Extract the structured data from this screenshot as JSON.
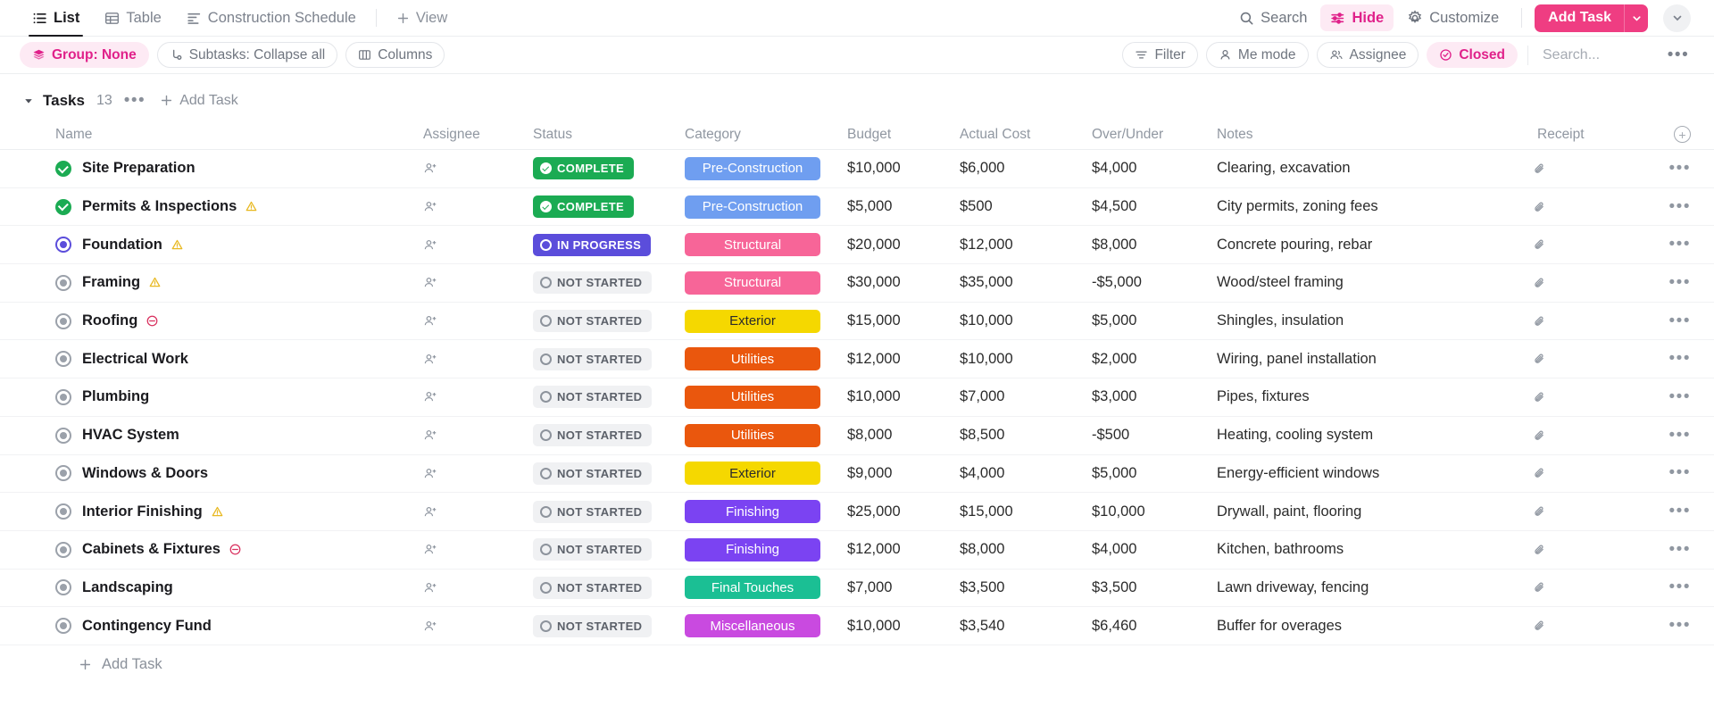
{
  "viewbar": {
    "tabs": [
      {
        "label": "List",
        "icon": "list-icon",
        "active": true
      },
      {
        "label": "Table",
        "icon": "table-icon",
        "active": false
      },
      {
        "label": "Construction Schedule",
        "icon": "gantt-icon",
        "active": false
      }
    ],
    "add_view_label": "View",
    "search_label": "Search",
    "hide_label": "Hide",
    "customize_label": "Customize",
    "add_task_label": "Add Task"
  },
  "filterbar": {
    "group_label": "Group: None",
    "subtasks_label": "Subtasks: Collapse all",
    "columns_label": "Columns",
    "filter_label": "Filter",
    "me_mode_label": "Me mode",
    "assignee_label": "Assignee",
    "closed_label": "Closed",
    "search_placeholder": "Search..."
  },
  "group": {
    "title": "Tasks",
    "count": "13",
    "add_task_label": "Add Task"
  },
  "columns": {
    "name": "Name",
    "assignee": "Assignee",
    "status": "Status",
    "category": "Category",
    "budget": "Budget",
    "actual_cost": "Actual Cost",
    "over_under": "Over/Under",
    "notes": "Notes",
    "receipt": "Receipt"
  },
  "colors": {
    "accent_pink": "#ef3d82",
    "hide_pink": "#e0218a",
    "complete_green": "#1bab53",
    "progress_purple": "#5b4ddb",
    "not_started_grey": "#f0f1f3",
    "pre_construction": "#6f9ef0",
    "structural": "#f76598",
    "exterior": "#f5d800",
    "utilities": "#ea570d",
    "finishing": "#7b43f2",
    "final_touches": "#1bbf94",
    "miscellaneous": "#c94ae0"
  },
  "footer": {
    "add_task_label": "Add Task"
  },
  "tasks": [
    {
      "name": "Site Preparation",
      "marker": "complete",
      "flag": "none",
      "status": "COMPLETE",
      "status_kind": "complete",
      "category": "Pre-Construction",
      "category_color": "#6f9ef0",
      "category_text": "#ffffff",
      "budget": "$10,000",
      "actual": "$6,000",
      "over_under": "$4,000",
      "notes": "Clearing, excavation"
    },
    {
      "name": "Permits & Inspections",
      "marker": "complete",
      "flag": "warning",
      "status": "COMPLETE",
      "status_kind": "complete",
      "category": "Pre-Construction",
      "category_color": "#6f9ef0",
      "category_text": "#ffffff",
      "budget": "$5,000",
      "actual": "$500",
      "over_under": "$4,500",
      "notes": "City permits, zoning fees"
    },
    {
      "name": "Foundation",
      "marker": "progress",
      "flag": "warning",
      "status": "IN PROGRESS",
      "status_kind": "progress",
      "category": "Structural",
      "category_color": "#f76598",
      "category_text": "#ffffff",
      "budget": "$20,000",
      "actual": "$12,000",
      "over_under": "$8,000",
      "notes": "Concrete pouring, rebar"
    },
    {
      "name": "Framing",
      "marker": "notstarted",
      "flag": "warning",
      "status": "NOT STARTED",
      "status_kind": "notstarted",
      "category": "Structural",
      "category_color": "#f76598",
      "category_text": "#ffffff",
      "budget": "$30,000",
      "actual": "$35,000",
      "over_under": "-$5,000",
      "notes": "Wood/steel framing"
    },
    {
      "name": "Roofing",
      "marker": "notstarted",
      "flag": "blocked",
      "status": "NOT STARTED",
      "status_kind": "notstarted",
      "category": "Exterior",
      "category_color": "#f5d800",
      "category_text": "#2b2b2b",
      "budget": "$15,000",
      "actual": "$10,000",
      "over_under": "$5,000",
      "notes": "Shingles, insulation"
    },
    {
      "name": "Electrical Work",
      "marker": "notstarted",
      "flag": "none",
      "status": "NOT STARTED",
      "status_kind": "notstarted",
      "category": "Utilities",
      "category_color": "#ea570d",
      "category_text": "#ffffff",
      "budget": "$12,000",
      "actual": "$10,000",
      "over_under": "$2,000",
      "notes": "Wiring, panel installation"
    },
    {
      "name": "Plumbing",
      "marker": "notstarted",
      "flag": "none",
      "status": "NOT STARTED",
      "status_kind": "notstarted",
      "category": "Utilities",
      "category_color": "#ea570d",
      "category_text": "#ffffff",
      "budget": "$10,000",
      "actual": "$7,000",
      "over_under": "$3,000",
      "notes": "Pipes, fixtures"
    },
    {
      "name": "HVAC System",
      "marker": "notstarted",
      "flag": "none",
      "status": "NOT STARTED",
      "status_kind": "notstarted",
      "category": "Utilities",
      "category_color": "#ea570d",
      "category_text": "#ffffff",
      "budget": "$8,000",
      "actual": "$8,500",
      "over_under": "-$500",
      "notes": "Heating, cooling system"
    },
    {
      "name": "Windows & Doors",
      "marker": "notstarted",
      "flag": "none",
      "status": "NOT STARTED",
      "status_kind": "notstarted",
      "category": "Exterior",
      "category_color": "#f5d800",
      "category_text": "#2b2b2b",
      "budget": "$9,000",
      "actual": "$4,000",
      "over_under": "$5,000",
      "notes": "Energy-efficient windows"
    },
    {
      "name": "Interior Finishing",
      "marker": "notstarted",
      "flag": "warning",
      "status": "NOT STARTED",
      "status_kind": "notstarted",
      "category": "Finishing",
      "category_color": "#7b43f2",
      "category_text": "#ffffff",
      "budget": "$25,000",
      "actual": "$15,000",
      "over_under": "$10,000",
      "notes": "Drywall, paint, flooring"
    },
    {
      "name": "Cabinets & Fixtures",
      "marker": "notstarted",
      "flag": "blocked",
      "status": "NOT STARTED",
      "status_kind": "notstarted",
      "category": "Finishing",
      "category_color": "#7b43f2",
      "category_text": "#ffffff",
      "budget": "$12,000",
      "actual": "$8,000",
      "over_under": "$4,000",
      "notes": "Kitchen, bathrooms"
    },
    {
      "name": "Landscaping",
      "marker": "notstarted",
      "flag": "none",
      "status": "NOT STARTED",
      "status_kind": "notstarted",
      "category": "Final Touches",
      "category_color": "#1bbf94",
      "category_text": "#ffffff",
      "budget": "$7,000",
      "actual": "$3,500",
      "over_under": "$3,500",
      "notes": "Lawn driveway, fencing"
    },
    {
      "name": "Contingency Fund",
      "marker": "notstarted",
      "flag": "none",
      "status": "NOT STARTED",
      "status_kind": "notstarted",
      "category": "Miscellaneous",
      "category_color": "#c94ae0",
      "category_text": "#ffffff",
      "budget": "$10,000",
      "actual": "$3,540",
      "over_under": "$6,460",
      "notes": "Buffer for overages"
    }
  ]
}
